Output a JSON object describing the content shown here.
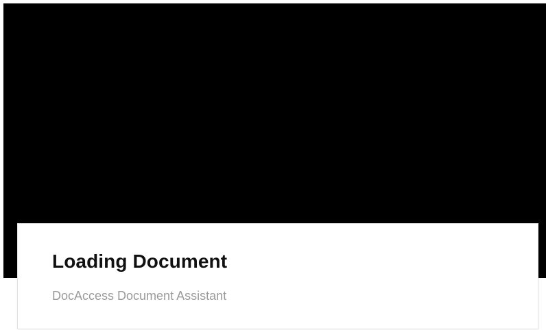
{
  "loading_card": {
    "title": "Loading Document",
    "subtitle": "DocAccess Document Assistant"
  },
  "colors": {
    "preview_background": "#000000",
    "card_background": "#ffffff",
    "title_color": "#111111",
    "subtitle_color": "#9a9a9a"
  }
}
